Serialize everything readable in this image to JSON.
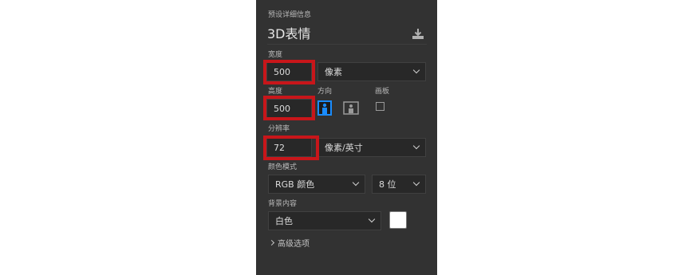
{
  "panel": {
    "section_header": "预设详细信息",
    "preset_name": "3D表情",
    "width": {
      "label": "宽度",
      "value": "500",
      "unit": "像素"
    },
    "height": {
      "label": "高度",
      "value": "500"
    },
    "orientation": {
      "label": "方向",
      "selected": "portrait"
    },
    "artboard": {
      "label": "画板",
      "checked": false
    },
    "resolution": {
      "label": "分辨率",
      "value": "72",
      "unit": "像素/英寸"
    },
    "color_mode": {
      "label": "颜色模式",
      "mode": "RGB 颜色",
      "depth": "8 位"
    },
    "background": {
      "label": "背景内容",
      "value": "白色",
      "swatch_color": "#ffffff"
    },
    "advanced": {
      "label": "高级选项"
    }
  },
  "colors": {
    "panel_bg": "#323232",
    "field_bg": "#282828",
    "highlight": "#c8161a",
    "accent_blue": "#1a8cff"
  },
  "icons": {
    "save_preset": "download-icon",
    "portrait": "portrait-orientation-icon",
    "landscape": "landscape-orientation-icon",
    "dropdown": "chevron-down-icon",
    "advanced": "chevron-right-icon"
  }
}
